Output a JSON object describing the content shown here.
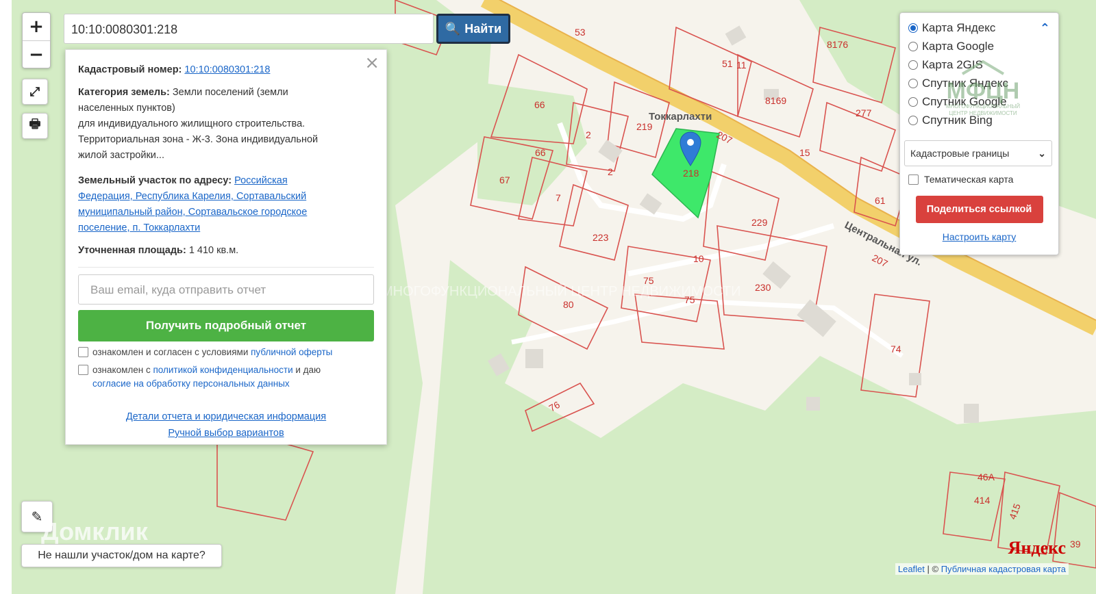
{
  "search": {
    "value": "10:10:0080301:218",
    "button_label": "Найти"
  },
  "info": {
    "cadastral_label": "Кадастровый номер:",
    "cadastral_value": "10:10:0080301:218",
    "category_label": "Категория земель:",
    "category_text_1": " Земли поселений (земли",
    "category_text_2": "населенных пунктов)",
    "category_text_3": "для индивидуального жилищного строительства.",
    "category_text_4": "Территориальная зона - Ж-3. Зона индивидуальной",
    "category_text_5": "жилой застройки...",
    "address_label": "Земельный участок по адресу:",
    "address_1": "Российская",
    "address_2": "Федерация, Республика Карелия, Сортавальский",
    "address_3": "муниципальный район, Сортавальское городское",
    "address_4": "поселение, п. Токкарлахти",
    "area_label": "Уточненная площадь:",
    "area_value": " 1 410 кв.м.",
    "email_placeholder": "Ваш email, куда отправить отчет",
    "report_button": "Получить подробный отчет",
    "chk1_text": "ознакомлен и согласен с условиями ",
    "chk1_link": "публичной оферты",
    "chk2_text": "ознакомлен с ",
    "chk2_link1": "политикой конфиденциальности",
    "chk2_text2": " и даю",
    "chk2_link2": "согласие на обработку персональных данных",
    "link_details": "Детали отчета и юридическая информация",
    "link_manual": "Ручной выбор вариантов"
  },
  "layers": {
    "options": [
      "Карта Яндекс",
      "Карта Google",
      "Карта 2GIS",
      "Спутник Яндекс",
      "Спутник Google",
      "Спутник Bing"
    ],
    "selected": "Карта Яндекс",
    "select_value": "Кадастровые границы",
    "thematic_label": "Тематическая карта",
    "share_button": "Поделиться ссылкой",
    "setup_link": "Настроить карту",
    "logo_text": "МФЦН",
    "logo_sub1": "МНОГОФУНКЦИОНАЛЬНЫЙ",
    "logo_sub2": "ЦЕНТР НЕДВИЖИМОСТИ"
  },
  "map": {
    "place_name": "Токкарлахти",
    "street_name": "Центральная ул.",
    "road_number_1": "207",
    "road_number_2": "207",
    "plot_numbers": [
      "53",
      "51",
      "11",
      "8176",
      "8169",
      "277",
      "219",
      "2",
      "66",
      "66",
      "67",
      "2",
      "218",
      "15",
      "61",
      "7",
      "229",
      "223",
      "10",
      "75",
      "75",
      "230",
      "80",
      "74",
      "76",
      "414",
      "415",
      "46А",
      "39"
    ],
    "watermark": "МНОГОФУНКЦИОНАЛЬНЫЙ ЦЕНТР НЕДВИЖИМОСТИ",
    "colors": {
      "green": "#d4ecc5",
      "background": "#f6f3ec",
      "plot_border": "#d9534f",
      "selected_plot": "#3ee86a",
      "road": "#f2d06b"
    }
  },
  "not_found": "Не нашли участок/дом на карте?",
  "attribution": {
    "leaflet": "Leaflet",
    "sep": " | © ",
    "source": "Публичная кадастровая карта"
  },
  "yandex_logo": "Яндекс",
  "domclick": "Домклик"
}
